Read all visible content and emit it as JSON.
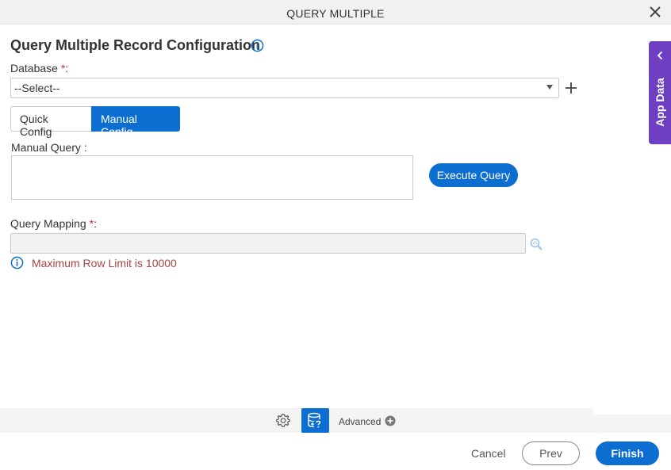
{
  "window": {
    "title": "QUERY MULTIPLE"
  },
  "heading": {
    "title": "Query Multiple Record Configuration"
  },
  "database": {
    "label": "Database",
    "required_mark": "*",
    "suffix": ":",
    "selected": "--Select--"
  },
  "config_tabs": {
    "quick": "Quick Config",
    "manual": "Manual Config",
    "active": "manual"
  },
  "manual_query": {
    "label": "Manual Query :",
    "value": ""
  },
  "execute_button": "Execute Query",
  "query_mapping": {
    "label": "Query Mapping",
    "required_mark": "*",
    "suffix": ":",
    "value": ""
  },
  "row_limit_note": "Maximum Row Limit is 10000",
  "side_panel": {
    "label": "App Data"
  },
  "bottom_toolbar": {
    "advanced_label": "Advanced"
  },
  "footer": {
    "cancel": "Cancel",
    "prev": "Prev",
    "finish": "Finish"
  },
  "colors": {
    "accent": "#0d6ed1",
    "side_tab": "#6f3fc2",
    "warning_text": "#a94442",
    "required": "#c0392b"
  }
}
